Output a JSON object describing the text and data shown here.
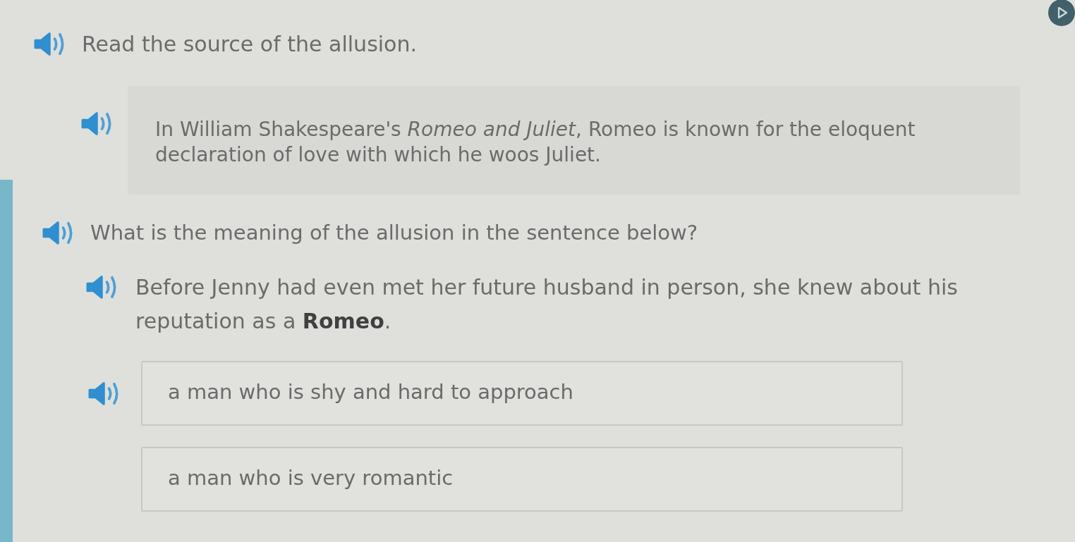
{
  "instruction": "Read the source of the allusion.",
  "source": {
    "text": "In William Shakespeare's *Romeo and Juliet*, Romeo is known for the eloquent declaration of love with which he woos Juliet."
  },
  "question": "What is the meaning of the allusion in the sentence below?",
  "sentence": "Before Jenny had even met her future husband in person, she knew about his reputation as a **Romeo**.",
  "choices": [
    {
      "text": "a man who is shy and hard to approach",
      "selected": false,
      "audio": true
    },
    {
      "text": "a man who is very romantic",
      "selected": false,
      "audio": false
    }
  ]
}
